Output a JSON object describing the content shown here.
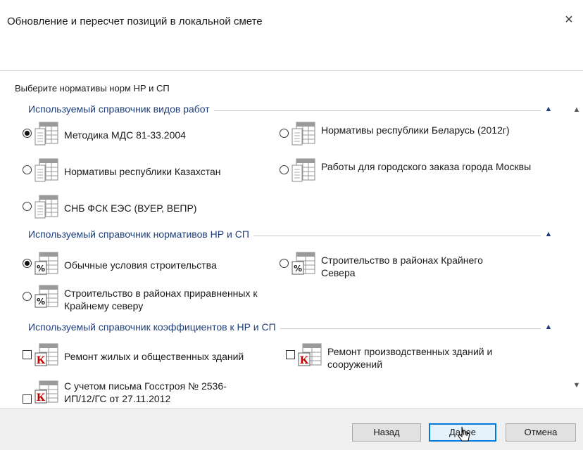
{
  "window": {
    "title": "Обновление и пересчет позиций в локальной смете",
    "close_glyph": "×"
  },
  "prompt": "Выберите нормативы норм НР и СП",
  "groups": [
    {
      "title": "Используемый справочник видов работ",
      "type": "radio",
      "icon": "document-grid-icon",
      "items": [
        {
          "label": "Методика МДС 81-33.2004",
          "checked": true
        },
        {
          "label": "Нормативы республики Беларусь (2012г)",
          "checked": false
        },
        {
          "label": "Нормативы республики Казахстан",
          "checked": false
        },
        {
          "label": "Работы для городского заказа города Москвы",
          "checked": false
        },
        {
          "label": "СНБ ФСК ЕЭС (ВУЕР, ВЕПР)",
          "checked": false
        }
      ]
    },
    {
      "title": "Используемый справочник нормативов НР и СП",
      "type": "radio",
      "icon": "percent-table-icon",
      "items": [
        {
          "label": "Обычные условия строительства",
          "checked": true
        },
        {
          "label": "Строительство в районах Крайнего Севера",
          "checked": false
        },
        {
          "label": "Строительство в районах приравненных к Крайнему северу",
          "checked": false
        }
      ]
    },
    {
      "title": "Используемый справочник коэффициентов к НР и СП",
      "type": "checkbox",
      "icon": "k-table-icon",
      "items": [
        {
          "label": "Ремонт жилых и общественных зданий",
          "checked": false
        },
        {
          "label": "Ремонт производственных зданий и сооружений",
          "checked": false
        },
        {
          "label": "С учетом письма Госстроя № 2536-ИП/12/ГС от 27.11.2012",
          "checked": false
        }
      ]
    }
  ],
  "buttons": {
    "back": "Назад",
    "next": "Далее",
    "cancel": "Отмена"
  },
  "colors": {
    "group_title": "#1f3e79",
    "accent": "#0078d7",
    "footer": "#f0f0f0",
    "k_icon": "#c00000"
  }
}
